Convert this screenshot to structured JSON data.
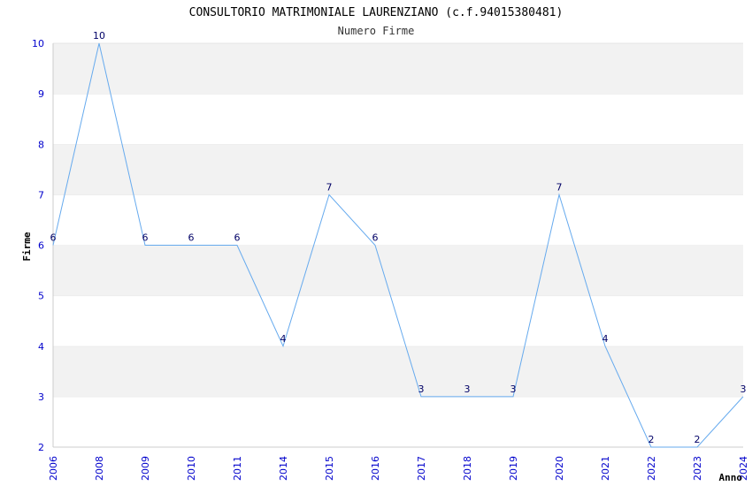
{
  "chart_data": {
    "type": "line",
    "title": "CONSULTORIO MATRIMONIALE LAURENZIANO (c.f.94015380481)",
    "subtitle": "Numero Firme",
    "xlabel": "Anno",
    "ylabel": "Firme",
    "categories": [
      "2006",
      "2008",
      "2009",
      "2010",
      "2011",
      "2014",
      "2015",
      "2016",
      "2017",
      "2018",
      "2019",
      "2020",
      "2021",
      "2022",
      "2023",
      "2024"
    ],
    "series": [
      {
        "values": [
          6,
          10,
          6,
          6,
          6,
          4,
          7,
          6,
          3,
          3,
          3,
          7,
          4,
          2,
          2,
          3
        ]
      }
    ],
    "ylim": [
      2,
      10
    ],
    "yticks": [
      "2",
      "3",
      "4",
      "5",
      "6",
      "7",
      "8",
      "9",
      "10"
    ],
    "grid": "horizontal bands",
    "colors": {
      "line": "#66aaee",
      "band": "#f2f2f2",
      "tick": "#0000cc",
      "label": "#000066"
    }
  }
}
